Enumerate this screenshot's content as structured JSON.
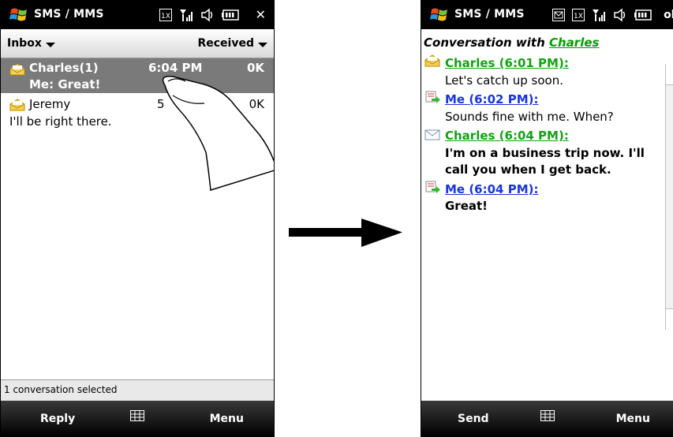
{
  "left_screen": {
    "title": "SMS / MMS",
    "title_right": "✕",
    "filter_left": "Inbox",
    "filter_right": "Received",
    "messages": [
      {
        "name": "Charles(1)",
        "time": "6:04 PM",
        "size": "0K",
        "preview": "Me: Great!",
        "selected": true
      },
      {
        "name": "Jeremy",
        "time": "5",
        "size": "0K",
        "preview": "I'll be right there.",
        "selected": false
      }
    ],
    "status_text": "1 conversation selected",
    "menu_left": "Reply",
    "menu_right": "Menu"
  },
  "right_screen": {
    "title": "SMS / MMS",
    "title_right": "ok",
    "conversation_prefix": "Conversation with",
    "conversation_contact": "Charles",
    "entries": [
      {
        "sender": "Charles (6:01 PM):",
        "text_lines": [
          "Let's catch up soon."
        ],
        "bold": false,
        "color": "green",
        "icon": "envelope-open-icon"
      },
      {
        "sender": "Me (6:02 PM):",
        "text_lines": [
          "Sounds fine with me. When?"
        ],
        "bold": false,
        "color": "blue",
        "icon": "sent-message-icon"
      },
      {
        "sender": "Charles (6:04 PM):",
        "text_lines": [
          "I'm on a business trip now. I'll",
          "call you when I get back."
        ],
        "bold": true,
        "color": "green",
        "icon": "envelope-closed-icon"
      },
      {
        "sender": "Me (6:04 PM):",
        "text_lines": [
          "Great!"
        ],
        "bold": true,
        "color": "blue",
        "icon": "sent-message-icon"
      }
    ],
    "menu_left": "Send",
    "menu_right": "Menu"
  },
  "colors": {
    "sender_green": "#14a014",
    "sender_blue": "#1a35d8",
    "selected_row": "#7a7a7a",
    "titlebar": "#000000"
  }
}
